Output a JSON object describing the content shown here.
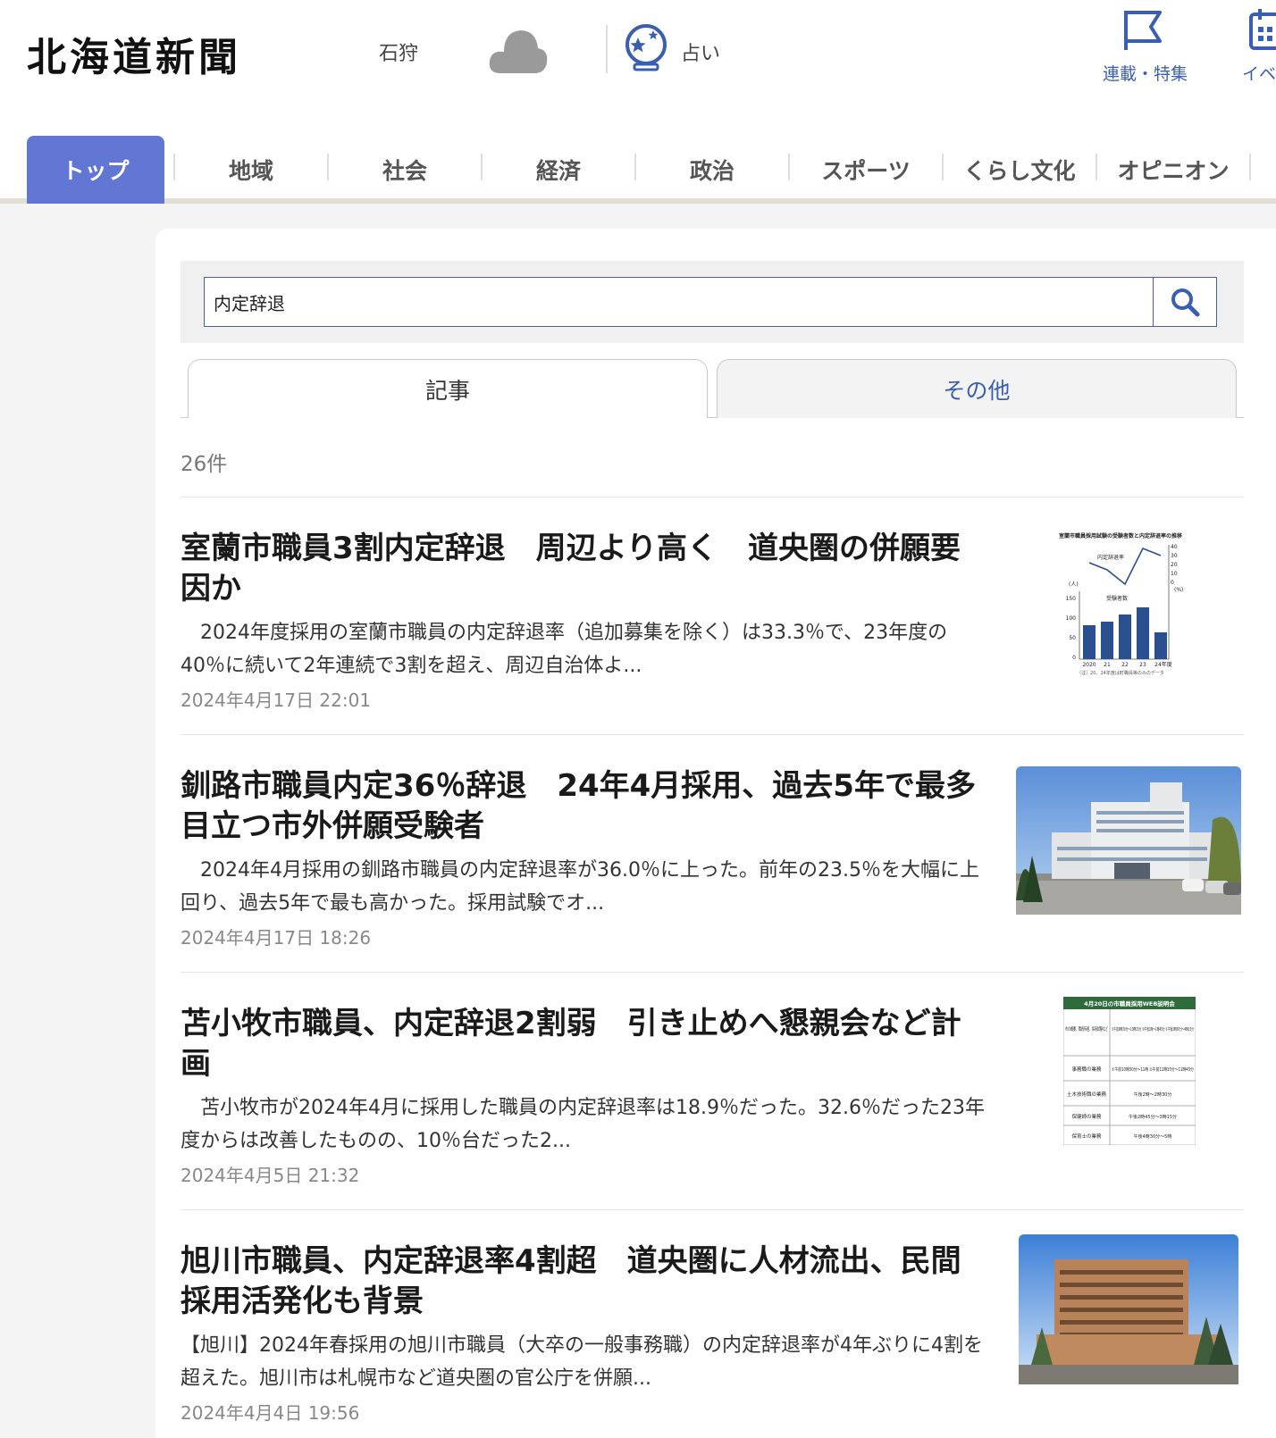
{
  "header": {
    "logo": "北海道新聞",
    "region": "石狩",
    "weather_icon": "cloud-icon",
    "fortune_label": "占い",
    "rensai_label": "連載・特集",
    "event_label": "イベン"
  },
  "nav": {
    "items": [
      "トップ",
      "地域",
      "社会",
      "経済",
      "政治",
      "スポーツ",
      "くらし文化",
      "オピニオン"
    ],
    "active": "トップ",
    "active_color": "#6177d3"
  },
  "search": {
    "value": "内定辞退",
    "button_icon": "search-icon"
  },
  "tabs": [
    "記事",
    "その他"
  ],
  "result_count": "26件",
  "articles": [
    {
      "title": "室蘭市職員3割内定辞退　周辺より高く　道央圏の併願要因か",
      "snippet": "　2024年度採用の室蘭市職員の内定辞退率（追加募集を除く）は33.3％で、23年度の40％に続いて2年連続で3割を超え、周辺自治体よ...",
      "date": "2024年4月17日 22:01",
      "thumb": {
        "title": "室蘭市職員採用試験の受験者数と内定辞退率の推移",
        "line_label": "内定辞退率",
        "bar_label": "受験者数",
        "left_unit": "(人)",
        "right_unit": "(%)",
        "left_ticks": [
          "150",
          "100",
          "50",
          "0"
        ],
        "right_ticks": [
          "40",
          "30",
          "20",
          "10",
          "0"
        ],
        "x_labels": [
          "2020",
          "21",
          "22",
          "23",
          "24年度"
        ],
        "note": "（注）20、24年度は町職員等のみのデータ"
      }
    },
    {
      "title": "釧路市職員内定36％辞退　24年4月採用、過去5年で最多　目立つ市外併願受験者",
      "snippet": "　2024年4月採用の釧路市職員の内定辞退率が36.0％に上った。前年の23.5％を大幅に上回り、過去5年で最も高かった。採用試験でオ...",
      "date": "2024年4月17日 18:26"
    },
    {
      "title": "苫小牧市職員、内定辞退2割弱　引き止めへ懇親会など計画",
      "snippet": "　苫小牧市が2024年4月に採用した職員の内定辞退率は18.9％だった。32.6％だった23年度からは改善したものの、10％台だった2...",
      "date": "2024年4月5日 21:32",
      "thumb": {
        "header": "4月20日の市職員採用WEB説明会",
        "rows": [
          [
            "市の概要、職員待遇、採用試験など",
            "①午前9時30分～10時15分 ②午後1時～1時45分 ③午後3時30分～4時15分"
          ],
          [
            "事務職の業務",
            "①午前10時30分～11時 ②午前11時15分～11時45分"
          ],
          [
            "土木技術職の業務",
            "午後2時～2時30分"
          ],
          [
            "保健師の業務",
            "午後2時45分～3時15分"
          ],
          [
            "保育士の業務",
            "午後4時30分～5時"
          ]
        ]
      }
    },
    {
      "title": "旭川市職員、内定辞退率4割超　道央圏に人材流出、民間採用活発化も背景",
      "snippet": "【旭川】2024年春採用の旭川市職員（大卒の一般事務職）の内定辞退率が4年ぶりに4割を超えた。旭川市は札幌市など道央圏の官公庁を併願...",
      "date": "2024年4月4日 19:56"
    }
  ]
}
